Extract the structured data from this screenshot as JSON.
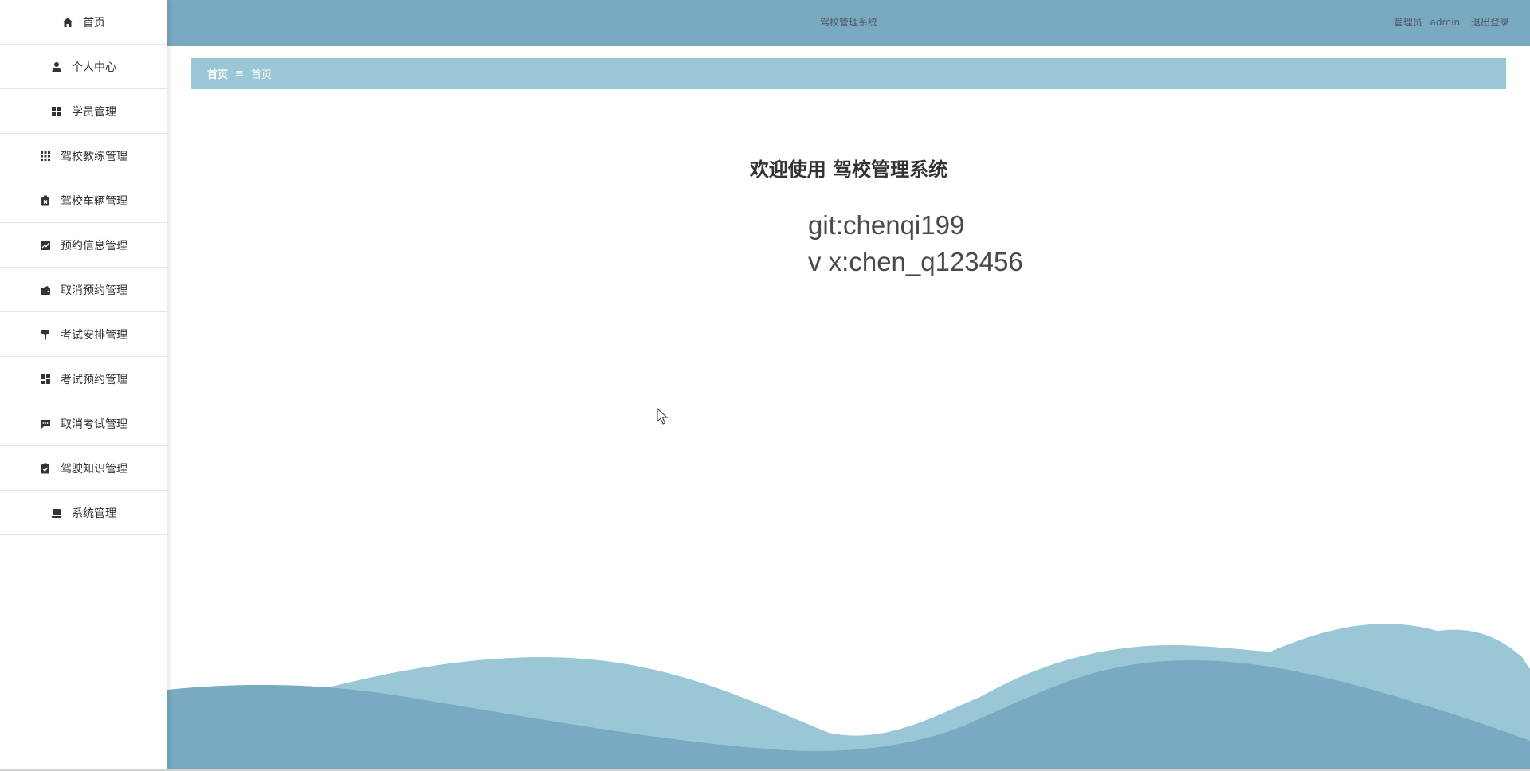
{
  "header": {
    "title": "驾校管理系统",
    "role_label": "管理员",
    "username": "admin",
    "logout_label": "退出登录",
    "bg_color": "#7aa9c2"
  },
  "sidebar": {
    "items": [
      {
        "label": "首页",
        "icon": "home-icon"
      },
      {
        "label": "个人中心",
        "icon": "user-icon"
      },
      {
        "label": "学员管理",
        "icon": "grid-icon"
      },
      {
        "label": "驾校教练管理",
        "icon": "apps-icon"
      },
      {
        "label": "驾校车辆管理",
        "icon": "clipboard-x-icon"
      },
      {
        "label": "预约信息管理",
        "icon": "chart-icon"
      },
      {
        "label": "取消预约管理",
        "icon": "wallet-icon"
      },
      {
        "label": "考试安排管理",
        "icon": "paint-roller-icon"
      },
      {
        "label": "考试预约管理",
        "icon": "dashboard-icon"
      },
      {
        "label": "取消考试管理",
        "icon": "chat-icon"
      },
      {
        "label": "驾驶知识管理",
        "icon": "clipboard-check-icon"
      },
      {
        "label": "系统管理",
        "icon": "laptop-icon"
      }
    ]
  },
  "breadcrumb": {
    "items": [
      "首页",
      "首页"
    ],
    "separator": "≡",
    "bg_color": "#99c7d6"
  },
  "main": {
    "welcome": "欢迎使用 驾校管理系统",
    "line1": "git:chenqi199",
    "line2": "v x:chen_q123456"
  },
  "colors": {
    "wave_dark": "#79aac1",
    "wave_light": "#99c7d6"
  }
}
